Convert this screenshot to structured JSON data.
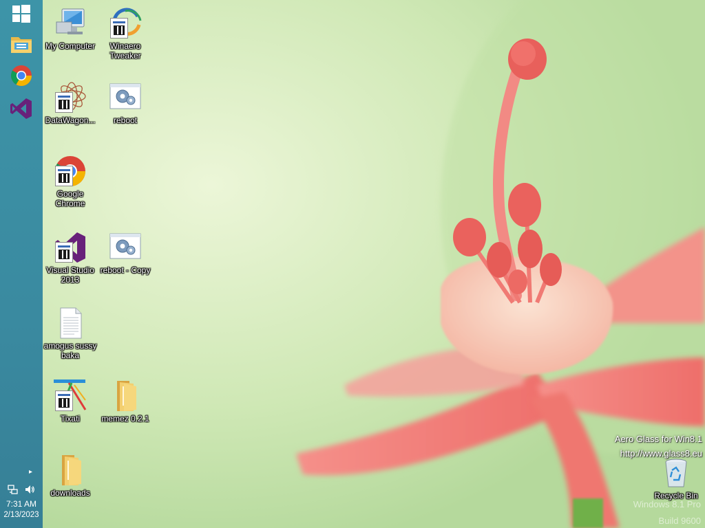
{
  "taskbar": {
    "pinned": [
      {
        "name": "windows-start-icon"
      },
      {
        "name": "file-explorer-icon"
      },
      {
        "name": "chrome-icon"
      },
      {
        "name": "visual-studio-icon"
      }
    ],
    "clock": {
      "time": "7:31 AM",
      "date": "2/13/2023"
    }
  },
  "desktop": {
    "icons": [
      {
        "label": "My Computer",
        "icon": "computer-icon"
      },
      {
        "label": "Winaero Tweaker",
        "icon": "winaero-tweaker-icon"
      },
      {
        "label": "DataWagon...",
        "icon": "datawagon-icon"
      },
      {
        "label": "reboot",
        "icon": "gear-script-icon"
      },
      {
        "label": "Google Chrome",
        "icon": "chrome-icon"
      },
      {
        "label": "Visual Studio 2013",
        "icon": "visual-studio-icon"
      },
      {
        "label": "reboot - Copy",
        "icon": "gear-script-icon"
      },
      {
        "label": "amogus sussy baka",
        "icon": "text-file-icon"
      },
      {
        "label": "Tixati",
        "icon": "tixati-icon"
      },
      {
        "label": "memez 0.2.1",
        "icon": "folder-icon"
      },
      {
        "label": "downloads",
        "icon": "folder-icon"
      },
      {
        "label": "Recycle Bin",
        "icon": "recycle-bin-icon"
      }
    ],
    "watermark": {
      "line1": "Aero Glass for Win8.1",
      "line2": "http://www.glass8.eu",
      "line3": "Windows 8.1 Pro",
      "line4": "Build 9600"
    }
  },
  "colors": {
    "taskbar": "#3a8aa0",
    "wallpaper_green": "#cde8b2",
    "flower_pink": "#f07d78"
  }
}
